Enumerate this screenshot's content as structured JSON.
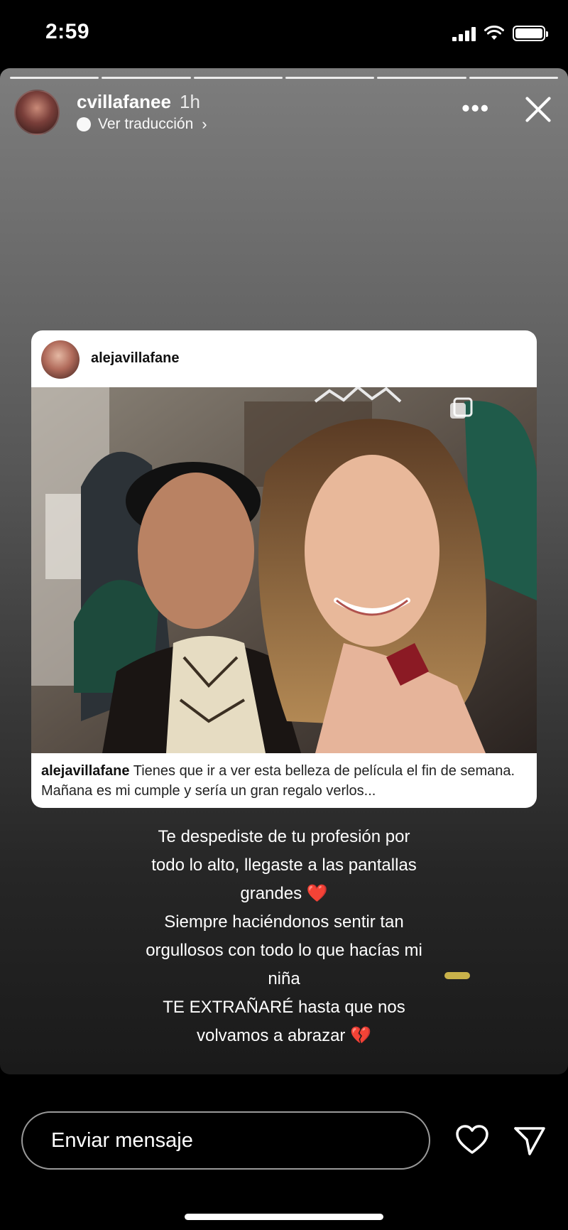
{
  "status_bar": {
    "time": "2:59",
    "icons": [
      "cellular-signal-icon",
      "wifi-icon",
      "battery-icon"
    ],
    "battery_level": 1.0
  },
  "story": {
    "segment_count": 6,
    "header": {
      "username": "cvillafanee",
      "time_ago": "1h",
      "translate_label": "Ver traducción",
      "more_icon": "more-horizontal-icon",
      "close_icon": "close-icon"
    },
    "shared_post": {
      "username": "alejavillafane",
      "caption_username": "alejavillafane",
      "caption_text": "Tienes que ir a ver esta belleza de película el fin de semana. Mañana es mi cumple y sería un gran regalo verlos...",
      "multi_image_icon": "multiple-photos-icon"
    },
    "text_lines": [
      "Te despediste de tu profesión por",
      "todo lo alto, llegaste a las pantallas",
      "grandes ❤️",
      "Siempre haciéndonos sentir tan",
      "orgullosos con todo lo que hacías mi",
      "niña",
      "TE EXTRAÑARÉ hasta que nos",
      "volvamos a abrazar 💔"
    ]
  },
  "bottom_bar": {
    "message_placeholder": "Enviar mensaje",
    "like_icon": "heart-outline-icon",
    "send_icon": "send-icon"
  },
  "colors": {
    "background": "#000000",
    "story_gradient_top": "#7d7d7d",
    "story_gradient_bottom": "#1a1a1a",
    "heart": "#e0242b",
    "sticker": "#c9b24a"
  }
}
